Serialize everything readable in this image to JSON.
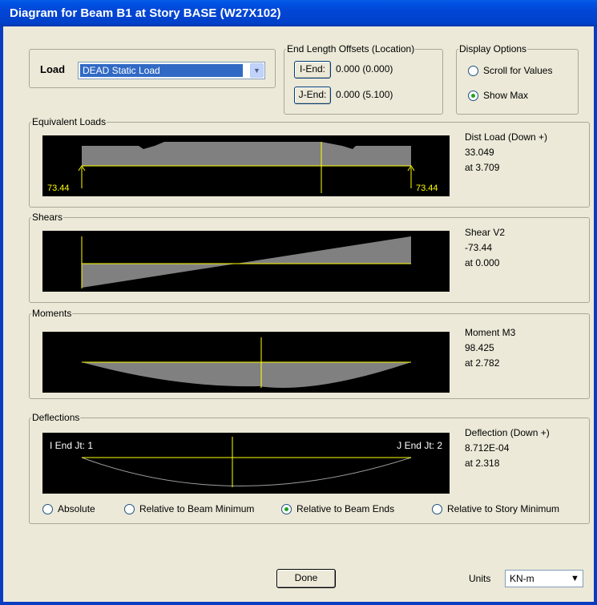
{
  "window": {
    "title": "Diagram for Beam B1 at Story BASE (W27X102)"
  },
  "load": {
    "label": "Load",
    "selected": "DEAD Static Load"
  },
  "end_offsets": {
    "title": "End Length Offsets (Location)",
    "i_end_button": "I-End:",
    "i_end_value": "0.000  (0.000)",
    "j_end_button": "J-End:",
    "j_end_value": "0.000  (5.100)"
  },
  "display_options": {
    "title": "Display Options",
    "options": [
      {
        "label": "Scroll for Values",
        "checked": false
      },
      {
        "label": "Show Max",
        "checked": true
      }
    ]
  },
  "equivalent_loads": {
    "title": "Equivalent Loads",
    "left_reaction": "73.44",
    "right_reaction": "73.44",
    "info_title": "Dist Load (Down +)",
    "info_value": "33.049",
    "info_at": "at 3.709"
  },
  "shears": {
    "title": "Shears",
    "info_title": "Shear V2",
    "info_value": "-73.44",
    "info_at": "at 0.000"
  },
  "moments": {
    "title": "Moments",
    "info_title": "Moment M3",
    "info_value": "98.425",
    "info_at": "at 2.782"
  },
  "deflections": {
    "title": "Deflections",
    "i_end_label": "I End Jt: 1",
    "j_end_label": "J End Jt: 2",
    "info_title": "Deflection (Down +)",
    "info_value": "8.712E-04",
    "info_at": "at 2.318",
    "modes": [
      {
        "label": "Absolute",
        "checked": false
      },
      {
        "label": "Relative to Beam Minimum",
        "checked": false
      },
      {
        "label": "Relative to Beam Ends",
        "checked": true
      },
      {
        "label": "Relative to Story Minimum",
        "checked": false
      }
    ]
  },
  "footer": {
    "done_button": "Done",
    "units_label": "Units",
    "units_value": "KN-m"
  },
  "colors": {
    "plot_bg": "#000000",
    "plot_fill": "#808080",
    "axis_line": "#ffff00",
    "label_text": "#ffff00",
    "title_bar": "#0046d5"
  },
  "icons": {
    "dropdown": "chevron-down-icon",
    "radio": "radio-button-icon"
  }
}
